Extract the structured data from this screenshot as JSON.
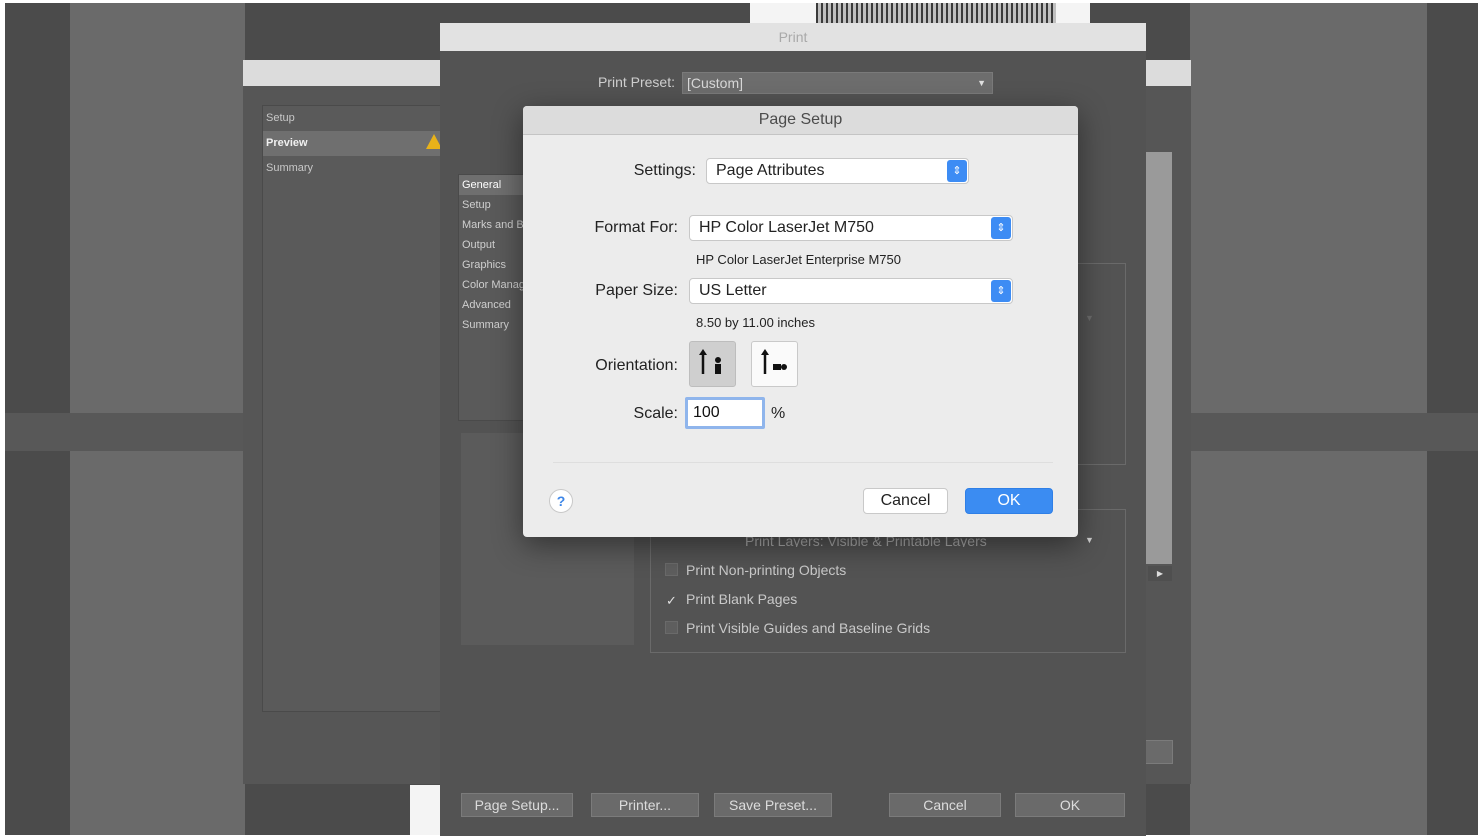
{
  "backdlg": {
    "items": [
      {
        "label": "Setup"
      },
      {
        "label": "Preview"
      },
      {
        "label": "Summary"
      }
    ]
  },
  "print": {
    "title": "Print",
    "preset_label": "Print Preset:",
    "preset_value": "[Custom]",
    "categories": [
      "General",
      "Setup",
      "Marks and Bleed",
      "Output",
      "Graphics",
      "Color Management",
      "Advanced",
      "Summary"
    ],
    "layers_text": "Print Layers:   Visible & Printable Layers",
    "options": [
      {
        "label": "Print Non-printing Objects",
        "checked": false
      },
      {
        "label": "Print Blank Pages",
        "checked": true
      },
      {
        "label": "Print Visible Guides and Baseline Grids",
        "checked": false
      }
    ],
    "buttons": {
      "page_setup": "Page Setup...",
      "printer": "Printer...",
      "save_preset": "Save Preset...",
      "cancel": "Cancel",
      "ok": "OK"
    }
  },
  "page_setup": {
    "title": "Page Setup",
    "settings_label": "Settings:",
    "settings_value": "Page Attributes",
    "format_label": "Format For:",
    "format_value": "HP Color LaserJet M750",
    "format_sub": "HP Color LaserJet Enterprise M750",
    "paper_label": "Paper Size:",
    "paper_value": "US Letter",
    "paper_sub": "8.50 by 11.00 inches",
    "orientation_label": "Orientation:",
    "orientation_selected": "portrait",
    "scale_label": "Scale:",
    "scale_value": "100",
    "scale_unit": "%",
    "help": "?",
    "cancel": "Cancel",
    "ok": "OK"
  },
  "colors": {
    "accent": "#3b8cf2",
    "warning": "#e8b21a"
  }
}
